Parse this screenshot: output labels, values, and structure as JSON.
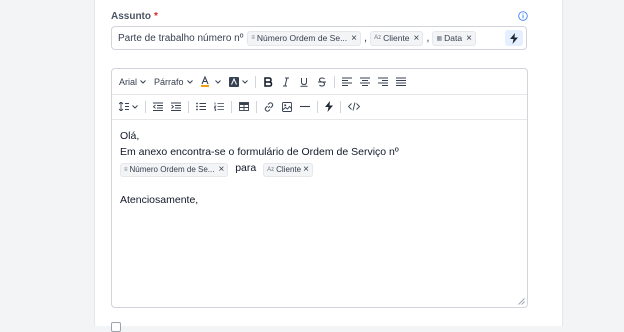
{
  "subject_field": {
    "label": "Assunto",
    "required_mark": "*",
    "prefix_text": "Parte de trabalho número nº",
    "chip_order": "Número Ordem de Se...",
    "chip_client": "Cliente",
    "chip_date": "Data",
    "separator": ","
  },
  "icons": {
    "info": "info-icon",
    "bolt": "lightning-icon",
    "close": "×",
    "list_glyph": "≡",
    "text_glyph": "Az",
    "calendar_glyph": "▦"
  },
  "toolbar": {
    "font": "Arial",
    "paragraph": "Párrafo"
  },
  "body": {
    "greeting": "Olá,",
    "line2": "Em anexo encontra-se o formulário de Ordem de Serviço nº",
    "chip_order": "Número Ordem de Se...",
    "connector": "para",
    "chip_client": "Cliente",
    "closing": "Atenciosamente,"
  },
  "colors": {
    "required": "#dc2626",
    "accent": "#3b82f6",
    "chip_bg": "#f3f4f6"
  }
}
